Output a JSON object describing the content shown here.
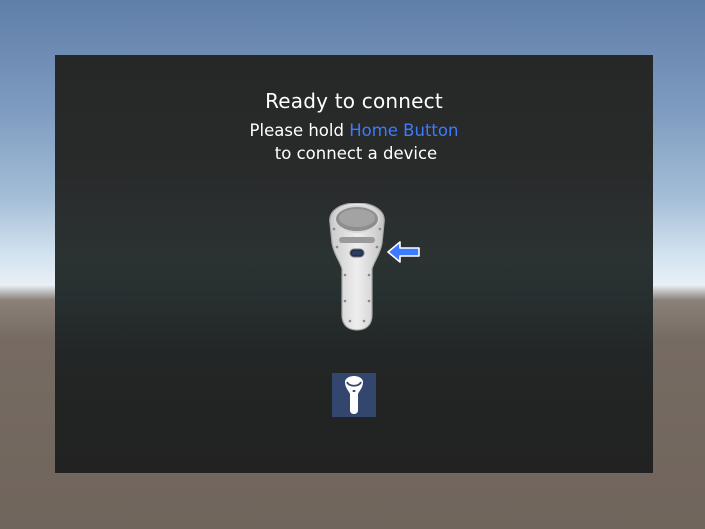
{
  "dialog": {
    "title": "Ready to connect",
    "instruction_prefix": "Please hold ",
    "instruction_highlight": "Home Button",
    "instruction_suffix": "to connect a device"
  },
  "icons": {
    "controller": "vr-controller-icon",
    "pointer": "arrow-left-icon",
    "device": "controller-device-icon"
  },
  "colors": {
    "accent": "#3c7bff",
    "panel": "#262828",
    "device_tile": "#33466d"
  }
}
